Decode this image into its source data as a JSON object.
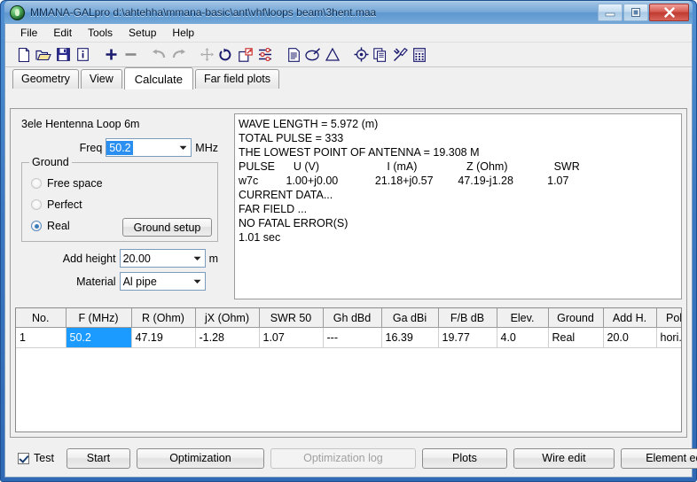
{
  "window": {
    "title": "MMANA-GALpro d:\\ahtehha\\mmana-basic\\ant\\vhf\\loops beam\\3hent.maa",
    "app_icon": "mmana-app-icon",
    "minimize_label": "Minimize",
    "maximize_label": "Maximize",
    "close_label": "Close",
    "titlebar_color": "#76a7d6",
    "frame_color": "#3b77c0"
  },
  "menubar": {
    "items": [
      {
        "label": "File"
      },
      {
        "label": "Edit"
      },
      {
        "label": "Tools"
      },
      {
        "label": "Setup"
      },
      {
        "label": "Help"
      }
    ]
  },
  "toolbar": {
    "icon_color": "#1b1b6e",
    "disabled_color": "#a8a8a8",
    "items": [
      {
        "name": "new-file-icon",
        "enabled": true
      },
      {
        "name": "open-folder-icon",
        "enabled": true
      },
      {
        "name": "save-disk-icon",
        "enabled": true
      },
      {
        "name": "info-icon",
        "enabled": true
      },
      {
        "name": "add-plus-icon",
        "enabled": true
      },
      {
        "name": "remove-minus-icon",
        "enabled": true
      },
      {
        "name": "undo-icon",
        "enabled": false
      },
      {
        "name": "redo-icon",
        "enabled": false
      },
      {
        "name": "move-arrows-icon",
        "enabled": false
      },
      {
        "name": "rotate-icon",
        "enabled": true
      },
      {
        "name": "scale-expand-icon",
        "enabled": true
      },
      {
        "name": "sliders-icon",
        "enabled": true
      },
      {
        "name": "document-icon",
        "enabled": true
      },
      {
        "name": "ellipse-draw-icon",
        "enabled": true
      },
      {
        "name": "triangle-icon",
        "enabled": true
      },
      {
        "name": "target-icon",
        "enabled": true
      },
      {
        "name": "copy-icon",
        "enabled": true
      },
      {
        "name": "tools-hammer-icon",
        "enabled": true
      },
      {
        "name": "calculator-icon",
        "enabled": true
      }
    ]
  },
  "tabs": {
    "active": "Calculate",
    "items": [
      {
        "label": "Geometry"
      },
      {
        "label": "View"
      },
      {
        "label": "Calculate"
      },
      {
        "label": "Far field plots"
      }
    ]
  },
  "calculate": {
    "model_title": "3ele Hentenna Loop 6m",
    "freq": {
      "label": "Freq",
      "value": "50.2",
      "unit": "MHz",
      "selected": true
    },
    "ground": {
      "legend": "Ground",
      "options": [
        {
          "label": "Free space",
          "checked": false
        },
        {
          "label": "Perfect",
          "checked": false
        },
        {
          "label": "Real",
          "checked": true
        }
      ],
      "setup_button": "Ground setup"
    },
    "add_height": {
      "label": "Add height",
      "value": "20.00",
      "unit": "m"
    },
    "material": {
      "label": "Material",
      "value": "Al pipe"
    },
    "results_lines": [
      "WAVE LENGTH = 5.972 (m)",
      "TOTAL PULSE = 333",
      "THE LOWEST POINT OF ANTENNA = 19.308 M",
      "PULSE      U (V)                      I (mA)                Z (Ohm)               SWR",
      "w7c         1.00+j0.00            21.18+j0.57        47.19-j1.28           1.07",
      "CURRENT DATA...",
      "FAR FIELD ...",
      "NO FATAL ERROR(S)",
      "1.01 sec"
    ]
  },
  "results_table": {
    "columns": [
      "No.",
      "F (MHz)",
      "R (Ohm)",
      "jX (Ohm)",
      "SWR 50",
      "Gh dBd",
      "Ga dBi",
      "F/B dB",
      "Elev.",
      "Ground",
      "Add H.",
      "Polar."
    ],
    "rows": [
      {
        "cells": [
          "1",
          "50.2",
          "47.19",
          "-1.28",
          "1.07",
          "---",
          "16.39",
          "19.77",
          "4.0",
          "Real",
          "20.0",
          "hori."
        ],
        "selected_cell_index": 1
      }
    ],
    "selection_color": "#1b9aff"
  },
  "bottombar": {
    "test_checkbox": {
      "label": "Test",
      "checked": true
    },
    "buttons": [
      {
        "label": "Start",
        "enabled": true
      },
      {
        "label": "Optimization",
        "enabled": true
      },
      {
        "label": "Optimization log",
        "enabled": false
      },
      {
        "label": "Plots",
        "enabled": true
      },
      {
        "label": "Wire edit",
        "enabled": true
      },
      {
        "label": "Element edit",
        "enabled": true
      }
    ]
  }
}
